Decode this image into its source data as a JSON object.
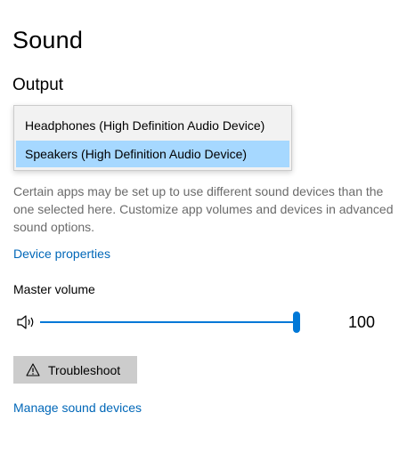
{
  "page": {
    "title": "Sound"
  },
  "output": {
    "section_title": "Output",
    "dropdown_options": [
      "Headphones (High Definition Audio Device)",
      "Speakers (High Definition Audio Device)"
    ],
    "selected_option": "Speakers (High Definition Audio Device)",
    "description": "Certain apps may be set up to use different sound devices than the one selected here. Customize app volumes and devices in advanced sound options.",
    "device_properties_link": "Device properties",
    "master_volume_label": "Master volume",
    "volume_value": "100",
    "volume_level_percent": 100,
    "troubleshoot_label": "Troubleshoot",
    "manage_devices_link": "Manage sound devices"
  },
  "icons": {
    "speaker": "speaker-icon",
    "warning": "warning-icon"
  },
  "colors": {
    "accent": "#0078d7",
    "link": "#0067b8",
    "selection": "#a6d8ff",
    "description_text": "#6b6b6b",
    "button_bg": "#cccccc"
  }
}
